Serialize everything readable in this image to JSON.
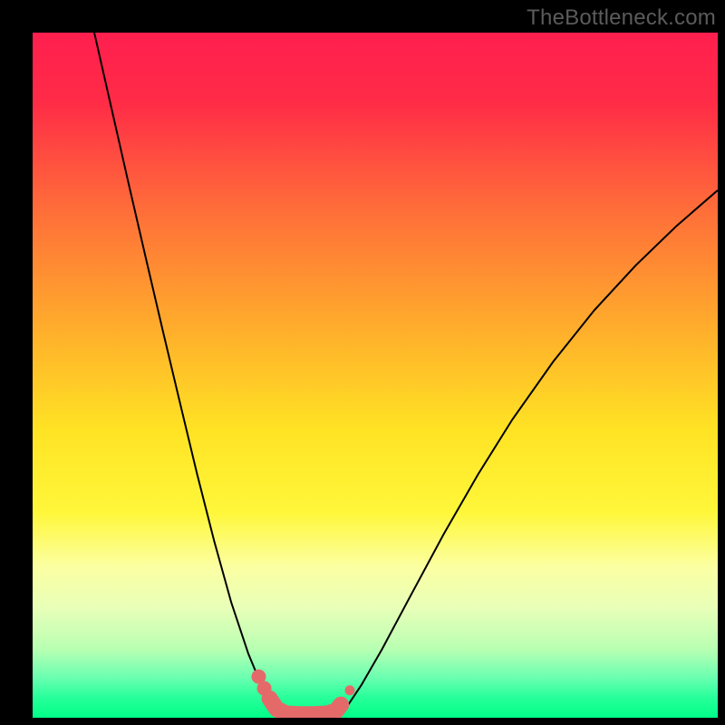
{
  "watermark": "TheBottleneck.com",
  "chart_data": {
    "type": "line",
    "title": "",
    "xlabel": "",
    "ylabel": "",
    "xlim": [
      0,
      1
    ],
    "ylim": [
      0,
      1
    ],
    "grid": false,
    "legend": false,
    "background_gradient": {
      "stops": [
        {
          "pos": 0.0,
          "color": "#ff1f4f"
        },
        {
          "pos": 0.1,
          "color": "#ff2b47"
        },
        {
          "pos": 0.25,
          "color": "#ff6a3a"
        },
        {
          "pos": 0.45,
          "color": "#ffb42a"
        },
        {
          "pos": 0.58,
          "color": "#ffe324"
        },
        {
          "pos": 0.7,
          "color": "#fff73a"
        },
        {
          "pos": 0.78,
          "color": "#fbffa2"
        },
        {
          "pos": 0.84,
          "color": "#e8ffb8"
        },
        {
          "pos": 0.9,
          "color": "#b8ffb2"
        },
        {
          "pos": 0.94,
          "color": "#6dffb1"
        },
        {
          "pos": 0.97,
          "color": "#28ff9a"
        },
        {
          "pos": 1.0,
          "color": "#00ff88"
        }
      ]
    },
    "series": [
      {
        "name": "left-curve",
        "stroke": "#000000",
        "stroke_width": 2,
        "x": [
          0.09,
          0.115,
          0.14,
          0.165,
          0.19,
          0.215,
          0.24,
          0.265,
          0.29,
          0.315,
          0.335,
          0.348,
          0.355,
          0.362
        ],
        "y": [
          1.0,
          0.89,
          0.78,
          0.672,
          0.565,
          0.46,
          0.356,
          0.258,
          0.168,
          0.093,
          0.045,
          0.022,
          0.012,
          0.007
        ]
      },
      {
        "name": "right-curve",
        "stroke": "#000000",
        "stroke_width": 2,
        "x": [
          0.448,
          0.46,
          0.48,
          0.51,
          0.55,
          0.6,
          0.65,
          0.7,
          0.76,
          0.82,
          0.88,
          0.94,
          1.0
        ],
        "y": [
          0.007,
          0.018,
          0.048,
          0.1,
          0.175,
          0.268,
          0.355,
          0.435,
          0.52,
          0.595,
          0.66,
          0.718,
          0.77
        ]
      },
      {
        "name": "valley-markers",
        "stroke": "#e46a6a",
        "stroke_width": 18,
        "marker_radius": 10,
        "x": [
          0.33,
          0.338,
          0.346,
          0.352,
          0.356,
          0.37,
          0.39,
          0.41,
          0.43,
          0.443,
          0.446,
          0.45,
          0.463
        ],
        "y": [
          0.06,
          0.043,
          0.028,
          0.019,
          0.013,
          0.006,
          0.005,
          0.005,
          0.006,
          0.01,
          0.014,
          0.019,
          0.04
        ]
      }
    ]
  }
}
